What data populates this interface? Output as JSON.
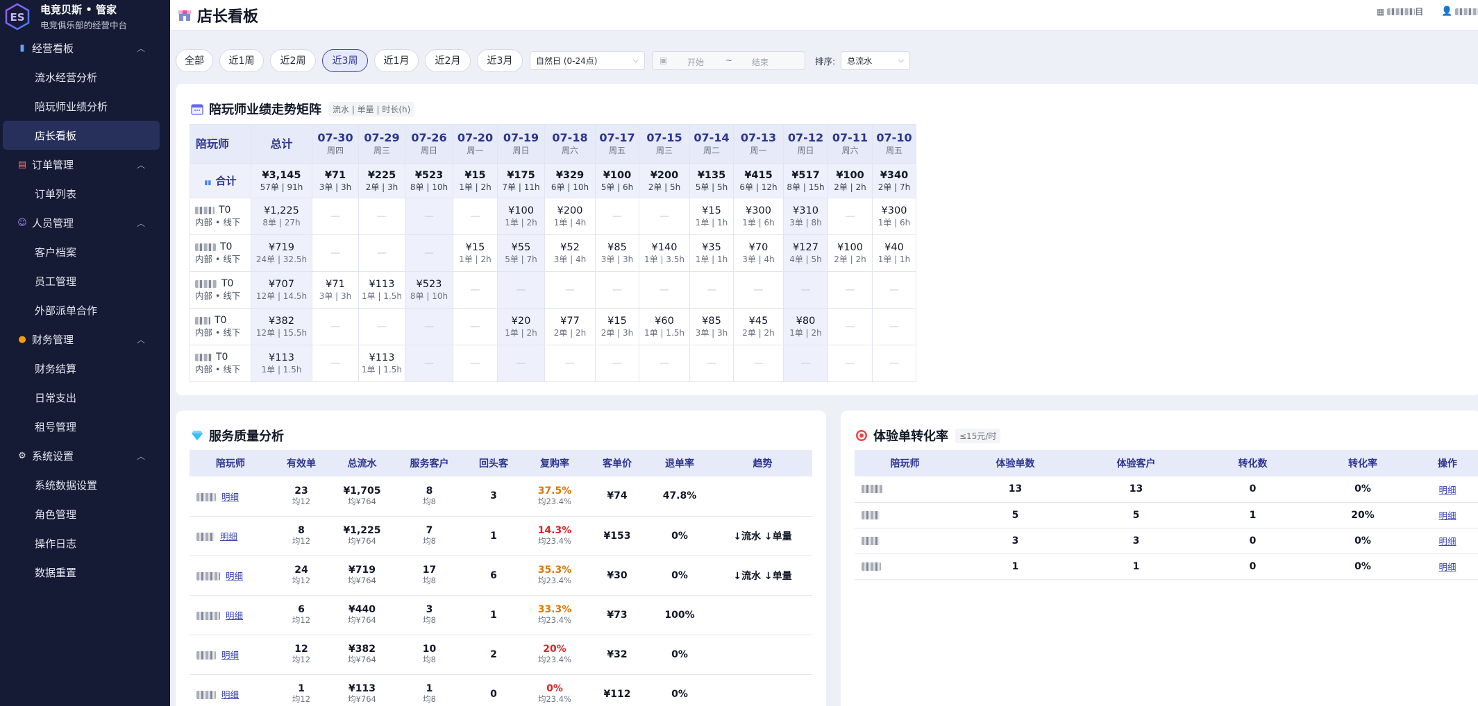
{
  "brand": {
    "title": "电竞贝斯 • 管家",
    "subtitle": "电竞俱乐部的经营中台"
  },
  "sidebar": {
    "groups": [
      {
        "label": "经营看板",
        "icon": "bar-chart-icon",
        "items": [
          "流水经营分析",
          "陪玩师业绩分析",
          "店长看板"
        ]
      },
      {
        "label": "订单管理",
        "icon": "clipboard-icon",
        "items": [
          "订单列表"
        ]
      },
      {
        "label": "人员管理",
        "icon": "users-icon",
        "items": [
          "客户档案",
          "员工管理",
          "外部派单合作"
        ]
      },
      {
        "label": "财务管理",
        "icon": "money-bag-icon",
        "items": [
          "财务结算",
          "日常支出",
          "租号管理"
        ]
      },
      {
        "label": "系统设置",
        "icon": "gear-icon",
        "items": [
          "系统数据设置",
          "角色管理",
          "操作日志",
          "数据重置"
        ]
      }
    ],
    "active_item": "店长看板"
  },
  "header": {
    "title": "店长看板",
    "user1_suffix": "目",
    "user2_suffix": "目"
  },
  "filters": {
    "ranges": [
      "全部",
      "近1周",
      "近2周",
      "近3周",
      "近1月",
      "近2月",
      "近3月"
    ],
    "active_range": "近3周",
    "day_type": "自然日 (0-24点)",
    "start_placeholder": "开始",
    "range_sep": "~",
    "end_placeholder": "结束",
    "sort_label": "排序:",
    "sort_value": "总流水"
  },
  "matrix": {
    "title": "陪玩师业绩走势矩阵",
    "subtitle": "流水 | 单量 | 时长(h)",
    "col_player": "陪玩师",
    "col_total": "总计",
    "dates": [
      {
        "d": "07-30",
        "w": "周四"
      },
      {
        "d": "07-29",
        "w": "周三"
      },
      {
        "d": "07-26",
        "w": "周日"
      },
      {
        "d": "07-20",
        "w": "周一"
      },
      {
        "d": "07-19",
        "w": "周日"
      },
      {
        "d": "07-18",
        "w": "周六"
      },
      {
        "d": "07-17",
        "w": "周五"
      },
      {
        "d": "07-15",
        "w": "周三"
      },
      {
        "d": "07-14",
        "w": "周二"
      },
      {
        "d": "07-13",
        "w": "周一"
      },
      {
        "d": "07-12",
        "w": "周日"
      },
      {
        "d": "07-11",
        "w": "周六"
      },
      {
        "d": "07-10",
        "w": "周五"
      }
    ],
    "total_row": {
      "label": "合计",
      "cells": [
        [
          "¥3,145",
          "57单 | 91h"
        ],
        [
          "¥71",
          "3单 | 3h"
        ],
        [
          "¥225",
          "2单 | 3h"
        ],
        [
          "¥523",
          "8单 | 10h"
        ],
        [
          "¥15",
          "1单 | 2h"
        ],
        [
          "¥175",
          "7单 | 11h"
        ],
        [
          "¥329",
          "6单 | 10h"
        ],
        [
          "¥100",
          "5单 | 6h"
        ],
        [
          "¥200",
          "2单 | 5h"
        ],
        [
          "¥135",
          "5单 | 5h"
        ],
        [
          "¥415",
          "6单 | 12h"
        ],
        [
          "¥517",
          "8单 | 15h"
        ],
        [
          "¥100",
          "2单 | 2h"
        ],
        [
          "¥340",
          "2单 | 7h"
        ]
      ]
    },
    "rows": [
      {
        "level": "T0",
        "tag": "内部 • 线下",
        "cells": [
          [
            "¥1,225",
            "8单 | 27h"
          ],
          null,
          null,
          null,
          null,
          [
            "¥100",
            "1单 | 2h"
          ],
          [
            "¥200",
            "1单 | 4h"
          ],
          null,
          null,
          [
            "¥15",
            "1单 | 1h"
          ],
          [
            "¥300",
            "1单 | 6h"
          ],
          [
            "¥310",
            "3单 | 8h"
          ],
          null,
          [
            "¥300",
            "1单 | 6h"
          ]
        ]
      },
      {
        "level": "T0",
        "tag": "内部 • 线下",
        "cells": [
          [
            "¥719",
            "24单 | 32.5h"
          ],
          null,
          null,
          null,
          [
            "¥15",
            "1单 | 2h"
          ],
          [
            "¥55",
            "5单 | 7h"
          ],
          [
            "¥52",
            "3单 | 4h"
          ],
          [
            "¥85",
            "3单 | 3h"
          ],
          [
            "¥140",
            "1单 | 3.5h"
          ],
          [
            "¥35",
            "1单 | 1h"
          ],
          [
            "¥70",
            "3单 | 4h"
          ],
          [
            "¥127",
            "4单 | 5h"
          ],
          [
            "¥100",
            "2单 | 2h"
          ],
          [
            "¥40",
            "1单 | 1h"
          ]
        ]
      },
      {
        "level": "T0",
        "tag": "内部 • 线下",
        "cells": [
          [
            "¥707",
            "12单 | 14.5h"
          ],
          [
            "¥71",
            "3单 | 3h"
          ],
          [
            "¥113",
            "1单 | 1.5h"
          ],
          [
            "¥523",
            "8单 | 10h"
          ],
          null,
          null,
          null,
          null,
          null,
          null,
          null,
          null,
          null,
          null
        ]
      },
      {
        "level": "T0",
        "tag": "内部 • 线下",
        "cells": [
          [
            "¥382",
            "12单 | 15.5h"
          ],
          null,
          null,
          null,
          null,
          [
            "¥20",
            "1单 | 2h"
          ],
          [
            "¥77",
            "2单 | 2h"
          ],
          [
            "¥15",
            "2单 | 3h"
          ],
          [
            "¥60",
            "1单 | 1.5h"
          ],
          [
            "¥85",
            "3单 | 3h"
          ],
          [
            "¥45",
            "2单 | 2h"
          ],
          [
            "¥80",
            "1单 | 2h"
          ],
          null,
          null
        ]
      },
      {
        "level": "T0",
        "tag": "内部 • 线下",
        "cells": [
          [
            "¥113",
            "1单 | 1.5h"
          ],
          null,
          [
            "¥113",
            "1单 | 1.5h"
          ],
          null,
          null,
          null,
          null,
          null,
          null,
          null,
          null,
          null,
          null,
          null
        ]
      }
    ],
    "dash": "—"
  },
  "service": {
    "title": "服务质量分析",
    "headers": [
      "陪玩师",
      "有效单",
      "总流水",
      "服务客户",
      "回头客",
      "复购率",
      "客单价",
      "退单率",
      "趋势"
    ],
    "link_label": "明细",
    "rows": [
      {
        "orders": "23",
        "orders_avg": "均12",
        "revenue": "¥1,705",
        "revenue_avg": "均¥764",
        "customers": "8",
        "customers_avg": "均8",
        "repeat": "3",
        "rate": "37.5%",
        "rate_color": "orange",
        "rate_avg": "均23.4%",
        "unit": "¥74",
        "refund": "47.8%",
        "refund_color": "green",
        "trend": ""
      },
      {
        "orders": "8",
        "orders_avg": "均12",
        "revenue": "¥1,225",
        "revenue_avg": "均¥764",
        "customers": "7",
        "customers_avg": "均8",
        "repeat": "1",
        "rate": "14.3%",
        "rate_color": "red",
        "rate_avg": "均23.4%",
        "unit": "¥153",
        "refund": "0%",
        "refund_color": "green",
        "trend": "↓流水 ↓单量"
      },
      {
        "orders": "24",
        "orders_avg": "均12",
        "revenue": "¥719",
        "revenue_avg": "均¥764",
        "customers": "17",
        "customers_avg": "均8",
        "repeat": "6",
        "rate": "35.3%",
        "rate_color": "orange",
        "rate_avg": "均23.4%",
        "unit": "¥30",
        "refund": "0%",
        "refund_color": "green",
        "trend": "↓流水 ↓单量"
      },
      {
        "orders": "6",
        "orders_avg": "均12",
        "revenue": "¥440",
        "revenue_avg": "均¥764",
        "customers": "3",
        "customers_avg": "均8",
        "repeat": "1",
        "rate": "33.3%",
        "rate_color": "orange",
        "rate_avg": "均23.4%",
        "unit": "¥73",
        "refund": "100%",
        "refund_color": "red",
        "trend": ""
      },
      {
        "orders": "12",
        "orders_avg": "均12",
        "revenue": "¥382",
        "revenue_avg": "均¥764",
        "customers": "10",
        "customers_avg": "均8",
        "repeat": "2",
        "rate": "20%",
        "rate_color": "red",
        "rate_avg": "均23.4%",
        "unit": "¥32",
        "refund": "0%",
        "refund_color": "green",
        "trend": ""
      },
      {
        "orders": "1",
        "orders_avg": "均12",
        "revenue": "¥113",
        "revenue_avg": "均¥764",
        "customers": "1",
        "customers_avg": "均8",
        "repeat": "0",
        "rate": "0%",
        "rate_color": "red",
        "rate_avg": "均23.4%",
        "unit": "¥112",
        "refund": "0%",
        "refund_color": "green",
        "trend": ""
      }
    ]
  },
  "trial": {
    "title": "体验单转化率",
    "subtitle": "≤15元/时",
    "headers": [
      "陪玩师",
      "体验单数",
      "体验客户",
      "转化数",
      "转化率",
      "操作"
    ],
    "link_label": "明细",
    "rows": [
      {
        "orders": "13",
        "customers": "13",
        "converted": "0",
        "rate": "0%"
      },
      {
        "orders": "5",
        "customers": "5",
        "converted": "1",
        "rate": "20%"
      },
      {
        "orders": "3",
        "customers": "3",
        "converted": "0",
        "rate": "0%"
      },
      {
        "orders": "1",
        "customers": "1",
        "converted": "0",
        "rate": "0%"
      }
    ]
  }
}
